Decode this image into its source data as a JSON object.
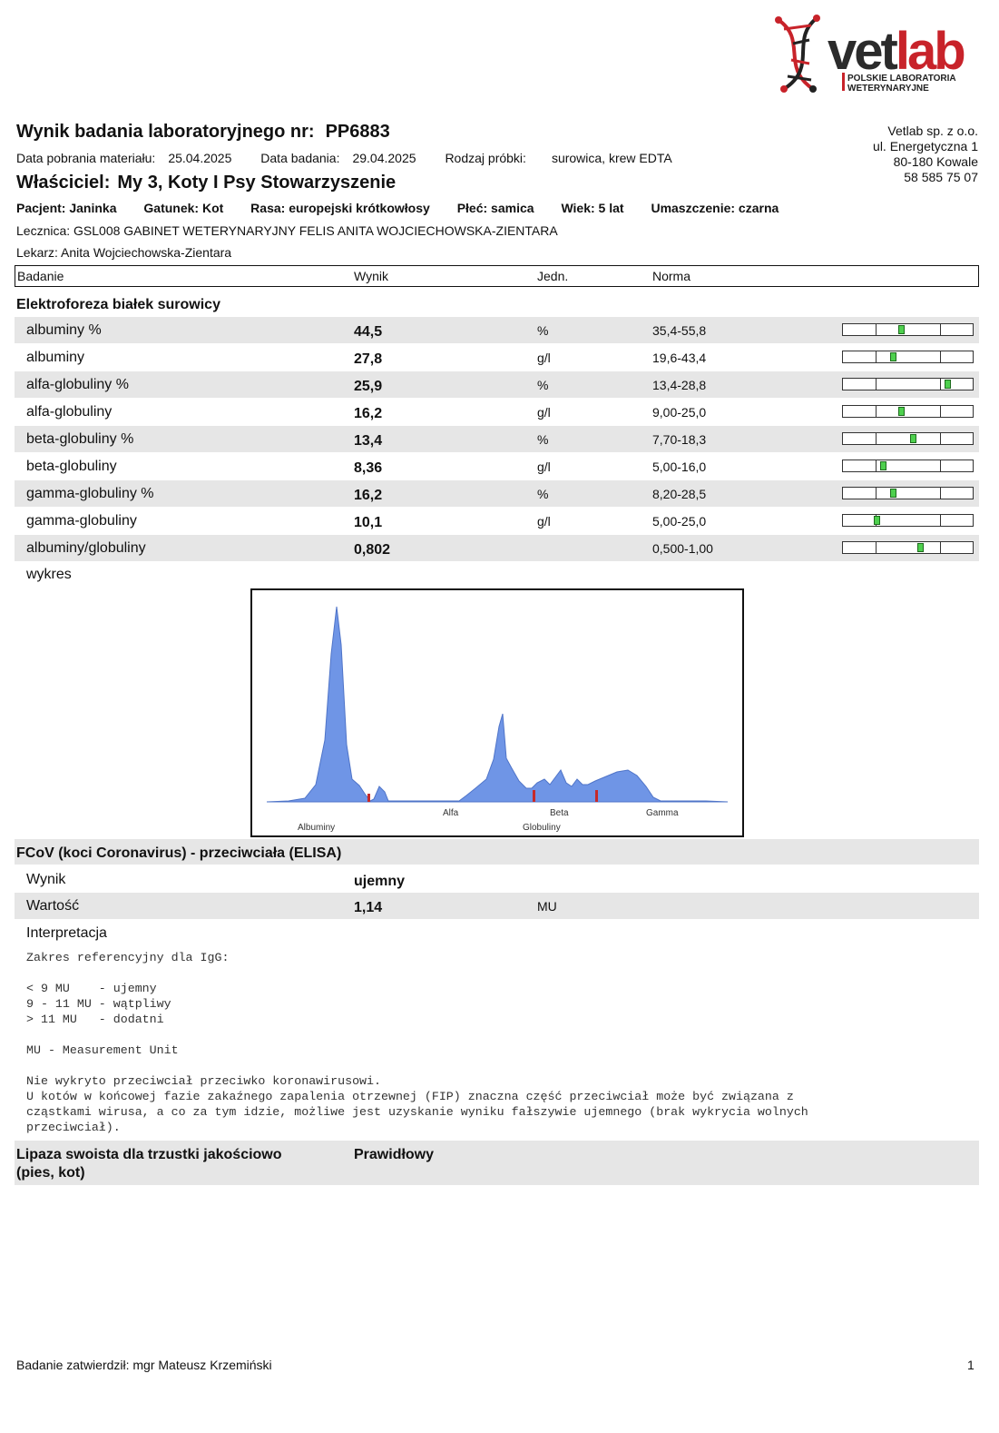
{
  "logo": {
    "brand": "vetlab",
    "sub1": "POLSKIE LABORATORIA",
    "sub2": "WETERYNARYJNE"
  },
  "header": {
    "title_label": "Wynik badania laboratoryjnego nr:",
    "title_number": "PP6883",
    "collection_label": "Data pobrania materiału:",
    "collection_date": "25.04.2025",
    "exam_label": "Data badania:",
    "exam_date": "29.04.2025",
    "sample_label": "Rodzaj próbki:",
    "sample_value": "surowica, krew EDTA"
  },
  "company": {
    "name": "Vetlab sp. z o.o.",
    "street": "ul. Energetyczna 1",
    "city": "80-180 Kowale",
    "phone": "58 585 75 07"
  },
  "owner": {
    "label": "Właściciel:",
    "value": "My 3, Koty I Psy Stowarzyszenie"
  },
  "patient": {
    "name": "Pacjent: Janinka",
    "species": "Gatunek: Kot",
    "breed": "Rasa: europejski krótkowłosy",
    "sex": "Płeć: samica",
    "age": "Wiek: 5 lat",
    "color": "Umaszczenie:  czarna"
  },
  "clinic": "Lecznica:  GSL008 GABINET WETERYNARYJNY FELIS ANITA WOJCIECHOWSKA-ZIENTARA",
  "doctor": "Lekarz: Anita Wojciechowska-Zientara",
  "table_header": {
    "test": "Badanie",
    "result": "Wynik",
    "unit": "Jedn.",
    "norm": "Norma"
  },
  "electro": {
    "title": "Elektroforeza białek surowicy",
    "rows": [
      {
        "name": "albuminy %",
        "value": "44,5",
        "unit": "%",
        "norm": "35,4-55,8",
        "level": 0.45
      },
      {
        "name": "albuminy",
        "value": "27,8",
        "unit": "g/l",
        "norm": "19,6-43,4",
        "level": 0.39
      },
      {
        "name": "alfa-globuliny %",
        "value": "25,9",
        "unit": "%",
        "norm": "13,4-28,8",
        "level": 0.81
      },
      {
        "name": "alfa-globuliny",
        "value": "16,2",
        "unit": "g/l",
        "norm": "9,00-25,0",
        "level": 0.45
      },
      {
        "name": "beta-globuliny %",
        "value": "13,4",
        "unit": "%",
        "norm": "7,70-18,3",
        "level": 0.54
      },
      {
        "name": "beta-globuliny",
        "value": "8,36",
        "unit": "g/l",
        "norm": "5,00-16,0",
        "level": 0.31
      },
      {
        "name": "gamma-globuliny %",
        "value": "16,2",
        "unit": "%",
        "norm": "8,20-28,5",
        "level": 0.39
      },
      {
        "name": "gamma-globuliny",
        "value": "10,1",
        "unit": "g/l",
        "norm": "5,00-25,0",
        "level": 0.26
      },
      {
        "name": "albuminy/globuliny",
        "value": "0,802",
        "unit": "",
        "norm": "0,500-1,00",
        "level": 0.6
      }
    ],
    "chart_label": "wykres"
  },
  "chart_labels": {
    "albuminy": "Albuminy",
    "alfa": "Alfa",
    "beta": "Beta",
    "gamma": "Gamma",
    "globuliny": "Globuliny"
  },
  "fcov": {
    "title": "FCoV (koci Coronavirus) - przeciwciała (ELISA)",
    "result_label": "Wynik",
    "result_value": "ujemny",
    "value_label": "Wartość",
    "value_value": "1,14",
    "value_unit": "MU",
    "interp_label": "Interpretacja",
    "interp_text": "Zakres referencyjny dla IgG:\n\n< 9 MU    - ujemny\n9 - 11 MU - wątpliwy\n> 11 MU   - dodatni\n\nMU - Measurement Unit\n\nNie wykryto przeciwciał przeciwko koronawirusowi.\nU kotów w końcowej fazie zakaźnego zapalenia otrzewnej (FIP) znaczna część przeciwciał może być związana z\ncząstkami wirusa, a co za tym idzie, możliwe jest uzyskanie wyniku fałszywie ujemnego (brak wykrycia wolnych\nprzeciwciał)."
  },
  "lipase": {
    "title_line1": "Lipaza swoista dla trzustki jakościowo",
    "title_line2": "(pies, kot)",
    "value": "Prawidłowy"
  },
  "footer": {
    "approved": "Badanie zatwierdził: mgr Mateusz Krzemiński",
    "page": "1"
  }
}
